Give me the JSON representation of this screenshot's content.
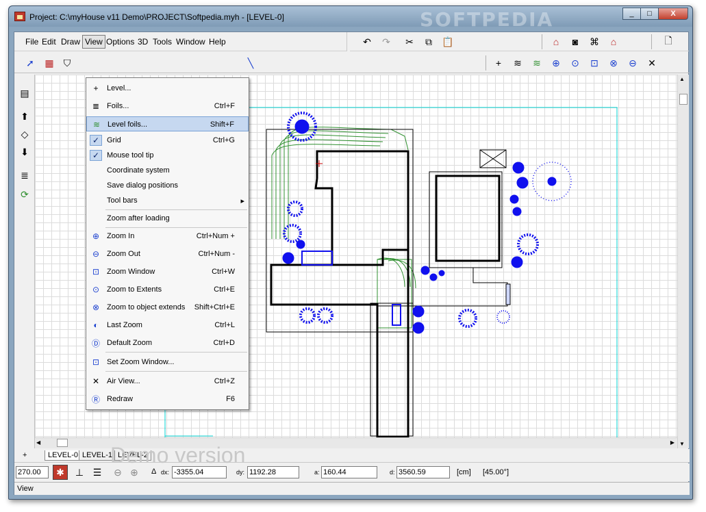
{
  "window": {
    "title": "Project: C:\\myHouse v11 Demo\\PROJECT\\Softpedia.myh - [LEVEL-0]",
    "watermark": "SOFTPEDIA",
    "min_label": "_",
    "max_label": "□",
    "close_label": "X"
  },
  "menubar": {
    "items": [
      {
        "label": "File"
      },
      {
        "label": "Edit"
      },
      {
        "label": "Draw"
      },
      {
        "label": "View"
      },
      {
        "label": "Options"
      },
      {
        "label": "3D"
      },
      {
        "label": "Tools"
      },
      {
        "label": "Window"
      },
      {
        "label": "Help"
      }
    ],
    "open_item": "View"
  },
  "view_menu": {
    "items": [
      {
        "label": "Level...",
        "shortcut": "",
        "icon": "plus-icon"
      },
      {
        "label": "Foils...",
        "shortcut": "Ctrl+F",
        "icon": "foils-icon"
      },
      {
        "label": "Level foils...",
        "shortcut": "Shift+F",
        "icon": "level-foils-icon",
        "highlighted": true
      },
      {
        "label": "Grid",
        "shortcut": "Ctrl+G",
        "checked": true
      },
      {
        "label": "Mouse tool tip",
        "shortcut": "",
        "checked": true
      },
      {
        "label": "Coordinate system",
        "shortcut": ""
      },
      {
        "label": "Save dialog positions",
        "shortcut": ""
      },
      {
        "label": "Tool bars",
        "shortcut": "",
        "submenu": true
      },
      {
        "label": "Zoom after loading",
        "shortcut": ""
      },
      {
        "label": "Zoom In",
        "shortcut": "Ctrl+Num +",
        "icon": "zoom-in-icon"
      },
      {
        "label": "Zoom Out",
        "shortcut": "Ctrl+Num -",
        "icon": "zoom-out-icon"
      },
      {
        "label": "Zoom Window",
        "shortcut": "Ctrl+W",
        "icon": "zoom-window-icon"
      },
      {
        "label": "Zoom to Extents",
        "shortcut": "Ctrl+E",
        "icon": "zoom-extents-icon"
      },
      {
        "label": "Zoom to object extends",
        "shortcut": "Shift+Ctrl+E",
        "icon": "zoom-object-icon"
      },
      {
        "label": "Last Zoom",
        "shortcut": "Ctrl+L",
        "icon": "last-zoom-icon"
      },
      {
        "label": "Default Zoom",
        "shortcut": "Ctrl+D",
        "icon": "default-zoom-icon"
      },
      {
        "label": "Set Zoom Window...",
        "shortcut": "",
        "icon": "set-zoom-icon"
      },
      {
        "label": "Air View...",
        "shortcut": "Ctrl+Z",
        "icon": "air-view-icon"
      },
      {
        "label": "Redraw",
        "shortcut": "F6",
        "icon": "redraw-icon"
      }
    ],
    "submenu_arrow": "▸"
  },
  "tabs": {
    "add_label": "+",
    "items": [
      {
        "label": "LEVEL-0",
        "active": true
      },
      {
        "label": "LEVEL-1"
      },
      {
        "label": "LEVEL-2"
      }
    ]
  },
  "coords": {
    "angle": "270.00",
    "delta_symbol": "Δ",
    "dx_label": "dx:",
    "dx": "-3355.04",
    "dy_label": "dy:",
    "dy": "1192.28",
    "a_label": "a:",
    "a": "160.44",
    "d_label": "d:",
    "d": "3560.59",
    "unit": "[cm]",
    "snap_angle": "[45.00°]"
  },
  "status": {
    "text": "View"
  },
  "canvas": {
    "demo_text": "Demo version",
    "watermark": "SOFTPEDIA"
  },
  "colors": {
    "accent": "#0000cc",
    "tree": "#1010ee",
    "garden": "#2f8f2f",
    "wall": "#000000",
    "cyan_border": "#00d0d0"
  }
}
